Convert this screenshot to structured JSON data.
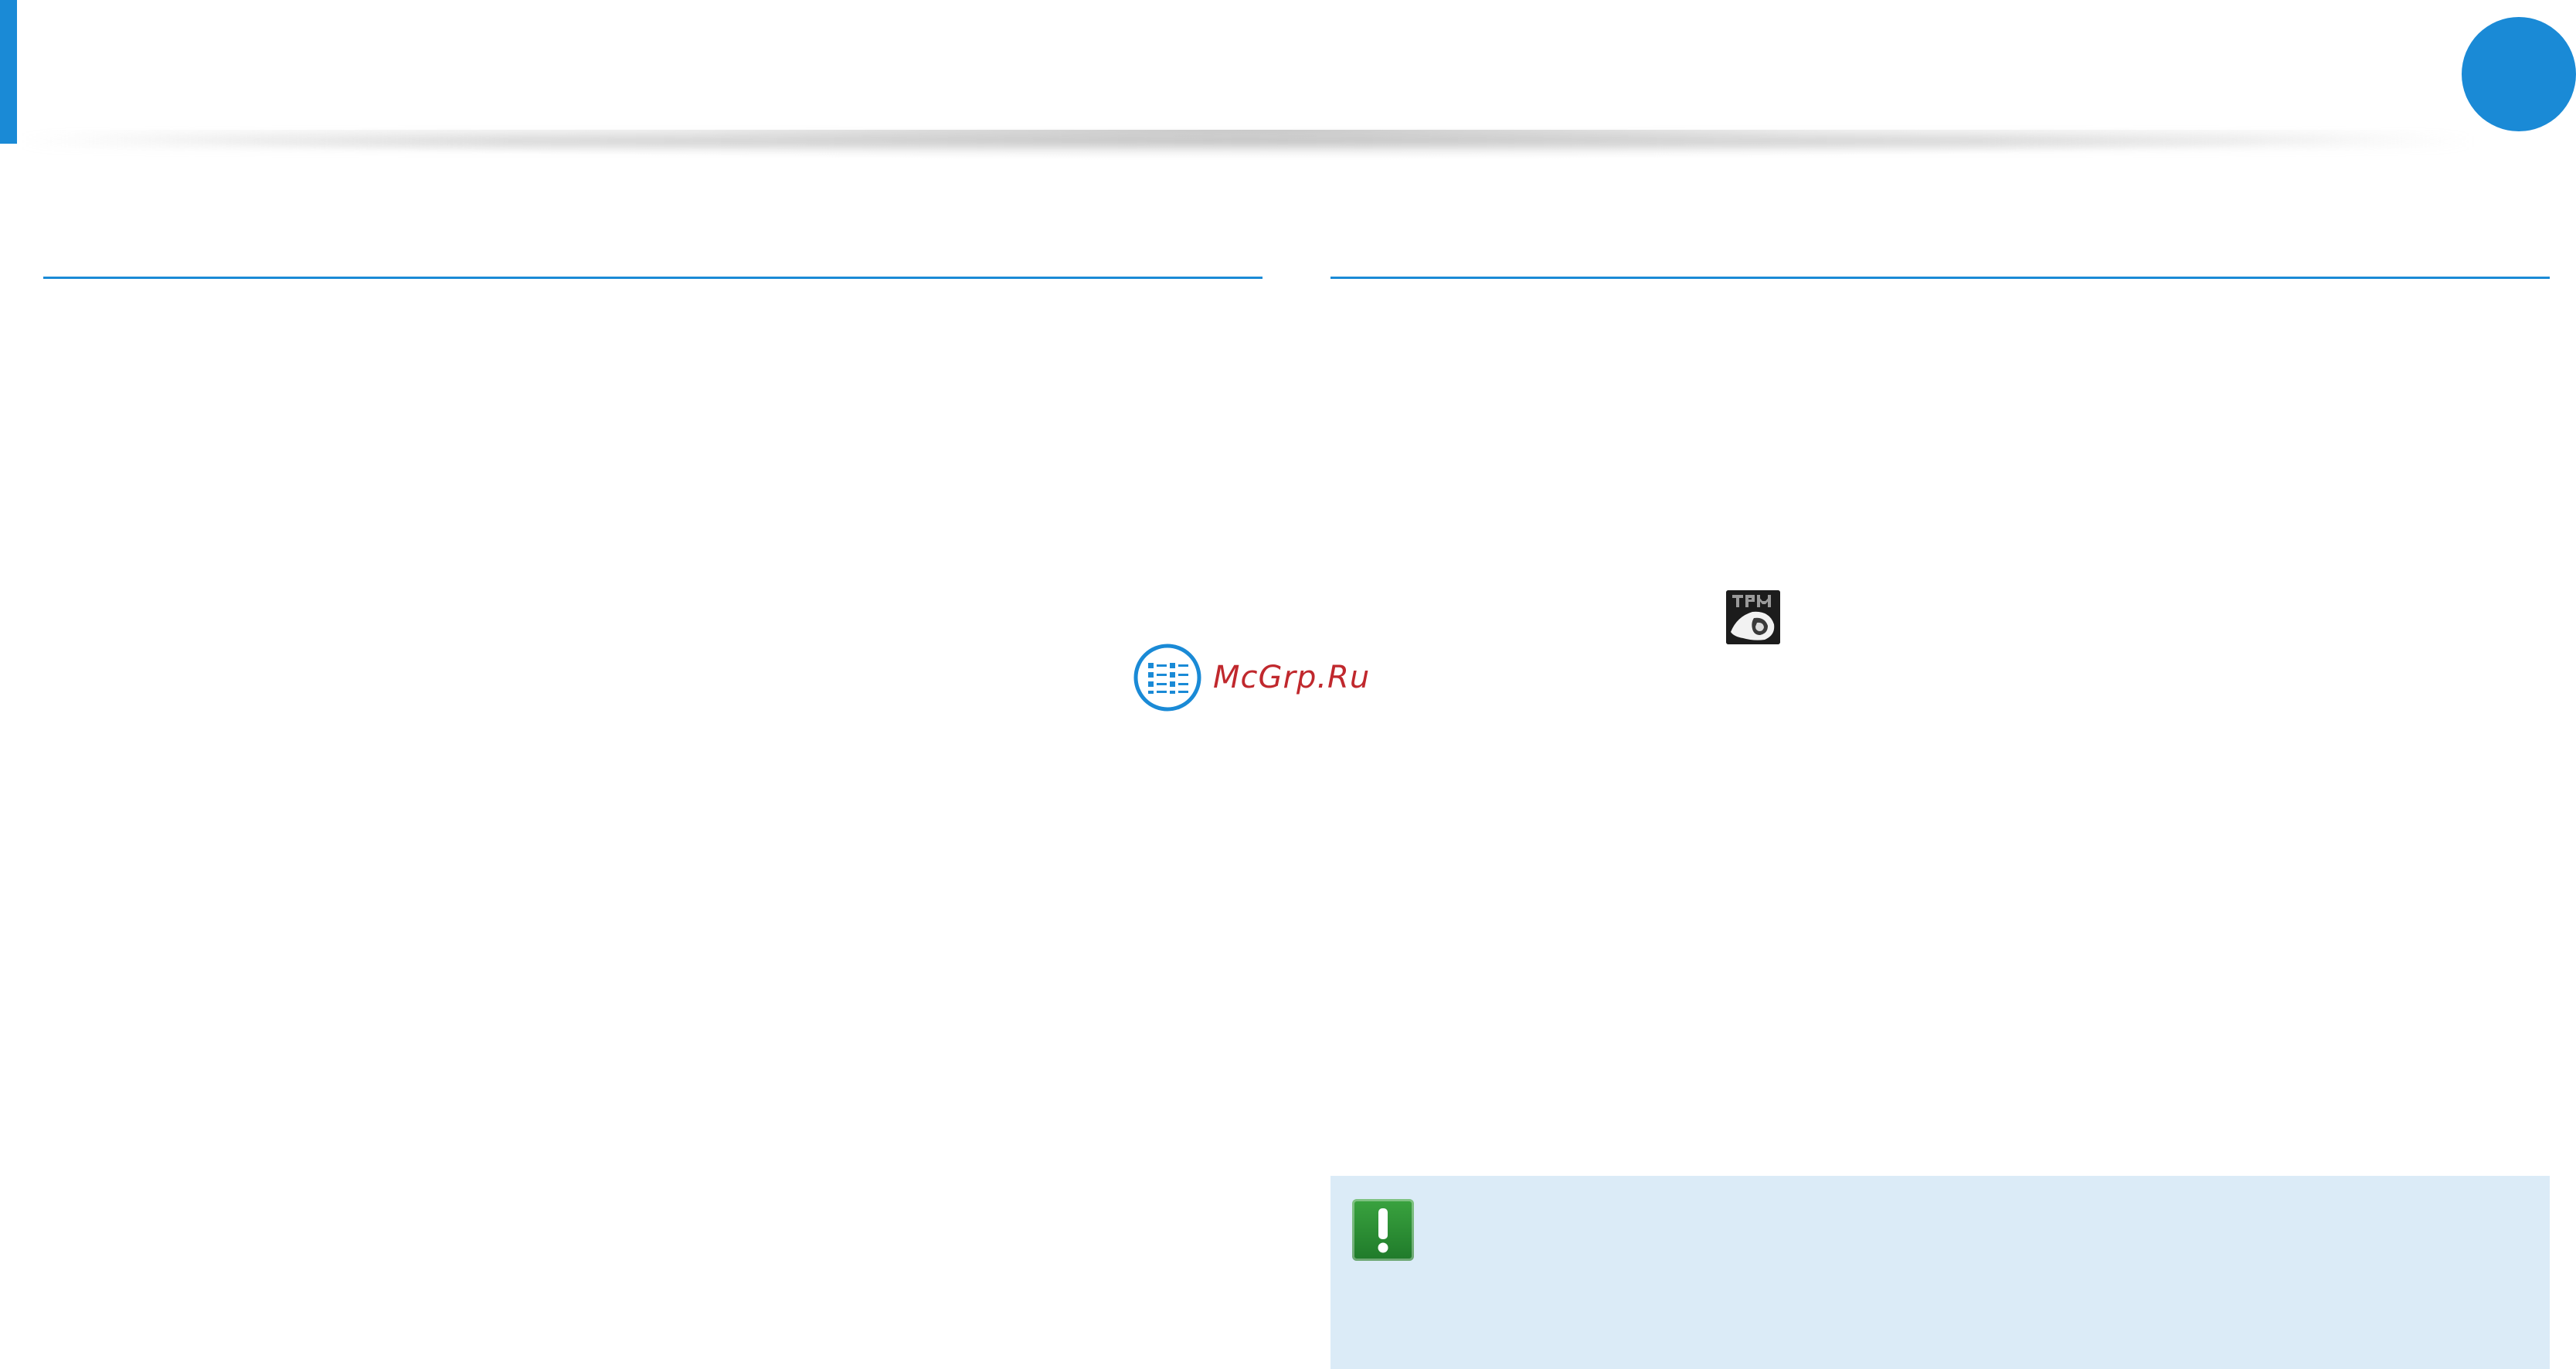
{
  "colors": {
    "accent": "#1a8ad6",
    "note_background": "#dbebf7",
    "caution_icon": "#2a8f35",
    "watermark": "#c0282d"
  },
  "icons": {
    "tpm": "tpm-icon",
    "caution": "exclamation-icon",
    "watermark_logo": "manual-list-icon"
  },
  "watermark": {
    "text": "McGrp.Ru"
  }
}
